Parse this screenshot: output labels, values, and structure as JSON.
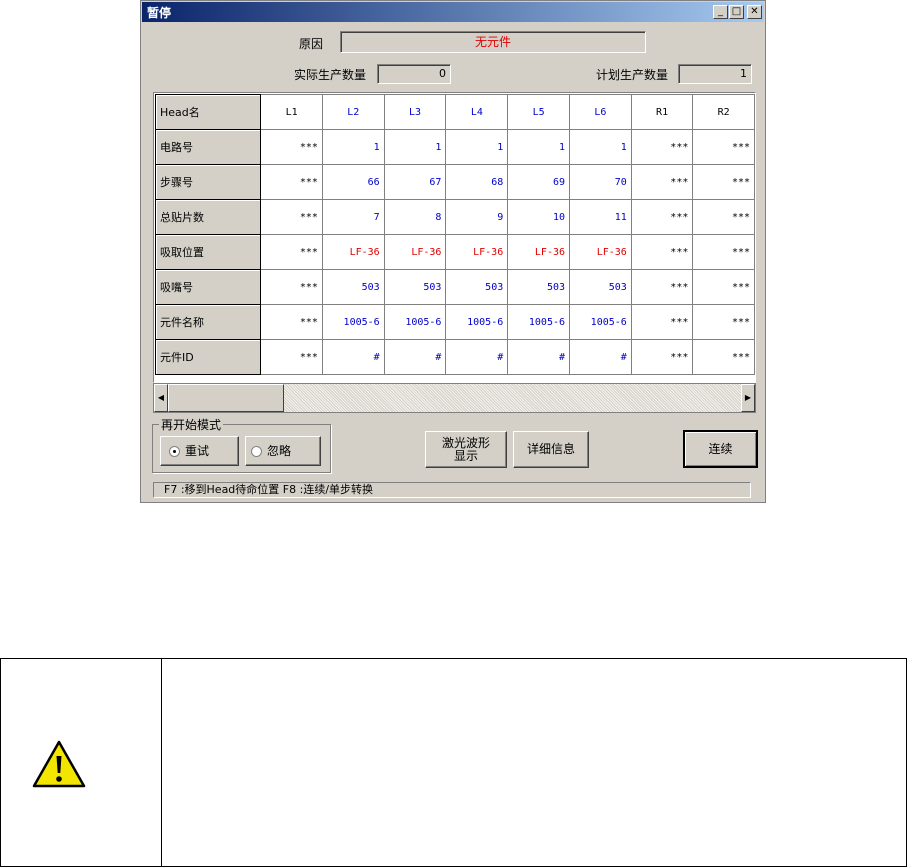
{
  "window": {
    "title": "暂停",
    "min_glyph": "_",
    "max_glyph": "□",
    "close_glyph": "✕"
  },
  "reason": {
    "label": "原因",
    "value": "无元件"
  },
  "actual": {
    "label": "实际生产数量",
    "value": "0"
  },
  "planned": {
    "label": "计划生产数量",
    "value": "1"
  },
  "grid": {
    "header_label": "Head名",
    "columns": [
      {
        "name": "L1",
        "color": "black"
      },
      {
        "name": "L2",
        "color": "blue"
      },
      {
        "name": "L3",
        "color": "blue"
      },
      {
        "name": "L4",
        "color": "blue"
      },
      {
        "name": "L5",
        "color": "blue"
      },
      {
        "name": "L6",
        "color": "blue"
      },
      {
        "name": "R1",
        "color": "black"
      },
      {
        "name": "R2",
        "color": "black"
      }
    ],
    "rows": [
      {
        "label": "电路号",
        "cells": [
          "***",
          "1",
          "1",
          "1",
          "1",
          "1",
          "***",
          "***"
        ]
      },
      {
        "label": "步骤号",
        "cells": [
          "***",
          "66",
          "67",
          "68",
          "69",
          "70",
          "***",
          "***"
        ]
      },
      {
        "label": "总贴片数",
        "cells": [
          "***",
          "7",
          "8",
          "9",
          "10",
          "11",
          "***",
          "***"
        ]
      },
      {
        "label": "吸取位置",
        "cells": [
          "***",
          "LF-36",
          "LF-36",
          "LF-36",
          "LF-36",
          "LF-36",
          "***",
          "***"
        ],
        "accent": "red"
      },
      {
        "label": "吸嘴号",
        "cells": [
          "***",
          "503",
          "503",
          "503",
          "503",
          "503",
          "***",
          "***"
        ]
      },
      {
        "label": "元件名称",
        "cells": [
          "***",
          "1005-6",
          "1005-6",
          "1005-6",
          "1005-6",
          "1005-6",
          "***",
          "***"
        ]
      },
      {
        "label": "元件ID",
        "cells": [
          "***",
          "#",
          "#",
          "#",
          "#",
          "#",
          "***",
          "***"
        ]
      }
    ]
  },
  "scroll": {
    "left_glyph": "◀",
    "right_glyph": "▶"
  },
  "restart_mode": {
    "title": "再开始模式",
    "options": [
      {
        "label": "重试",
        "selected": true
      },
      {
        "label": "忽略",
        "selected": false
      }
    ]
  },
  "buttons": {
    "laser_line1": "激光波形",
    "laser_line2": "显示",
    "details": "详细信息",
    "continuous": "连续"
  },
  "status_text": "F7 :移到Head待命位置  F8 :连续/单步转换",
  "colors": {
    "blue": "#0000c8",
    "red": "#e00000",
    "title_bar": "#0a246a",
    "face": "#d4d0c8",
    "warning_yellow": "#f2e600"
  },
  "caution": {
    "icon": "warning-triangle-icon"
  }
}
